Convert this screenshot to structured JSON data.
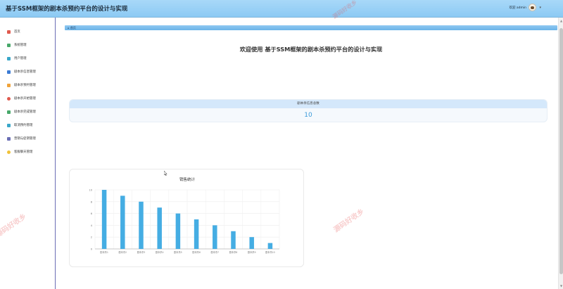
{
  "header": {
    "title": "基于SSM框架的剧本杀预约平台的设计与实现",
    "welcome_user": "欢迎 admin"
  },
  "sidebar": {
    "items": [
      {
        "label": "首页",
        "icon": "home-icon",
        "color": "#e05a4e"
      },
      {
        "label": "系统管理",
        "icon": "settings-icon",
        "color": "#48a86a"
      },
      {
        "label": "用户管理",
        "icon": "user-icon",
        "color": "#3aa7c9"
      },
      {
        "label": "剧本杀信息管理",
        "icon": "script-info-icon",
        "color": "#3b7bd4"
      },
      {
        "label": "剧本杀预约管理",
        "icon": "booking-icon",
        "color": "#f0a33a"
      },
      {
        "label": "剧本杀开始管理",
        "icon": "start-icon",
        "color": "#e05a4e"
      },
      {
        "label": "剧本杀完成管理",
        "icon": "finish-icon",
        "color": "#48a86a"
      },
      {
        "label": "取消预约管理",
        "icon": "cancel-icon",
        "color": "#3aa7c9"
      },
      {
        "label": "营销与促销管理",
        "icon": "promo-icon",
        "color": "#6b6fb5"
      },
      {
        "label": "客服聊天管理",
        "icon": "chat-icon",
        "color": "#f0c23a"
      }
    ]
  },
  "breadcrumb": {
    "home_label": "首页"
  },
  "main": {
    "welcome_title": "欢迎使用 基于SSM框架的剧本杀预约平台的设计与实现",
    "stat_label": "剧本杀信息总数",
    "stat_value": "10"
  },
  "watermark": {
    "text": "源码好收乡"
  },
  "colors": {
    "accent": "#3a9ad9",
    "bar": "#45ade3",
    "header": "#99cff6"
  },
  "chart_data": {
    "type": "bar",
    "title": "销售统计",
    "categories": [
      "剧本杀1",
      "剧本杀2",
      "剧本杀3",
      "剧本杀4",
      "剧本杀5",
      "剧本杀6",
      "剧本杀7",
      "剧本杀8",
      "剧本杀9",
      "剧本杀10"
    ],
    "values": [
      10,
      9,
      8,
      7,
      6,
      5,
      4,
      3,
      2,
      1
    ],
    "ylim": [
      0,
      10
    ],
    "yticks": [
      0,
      2,
      4,
      6,
      8,
      10
    ],
    "grid": true
  }
}
